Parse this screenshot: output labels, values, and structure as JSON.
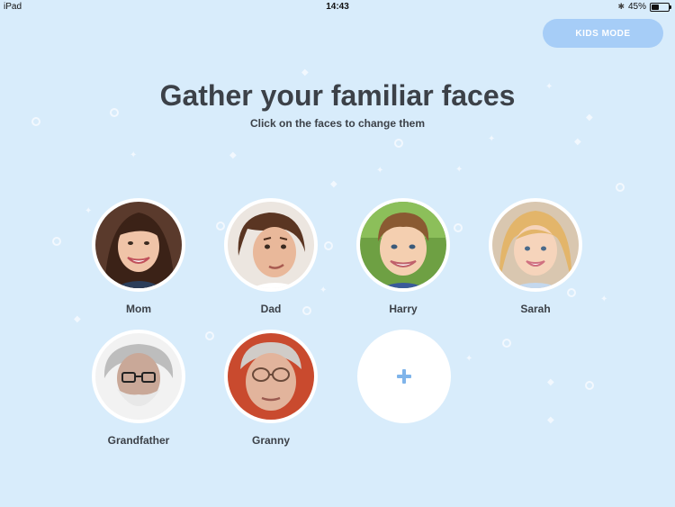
{
  "status_bar": {
    "device": "iPad",
    "time": "14:43",
    "battery": "45%",
    "battery_level": 0.45
  },
  "kids_mode_button": "KIDS MODE",
  "title": "Gather your familiar faces",
  "subtitle": "Click on the faces to change them",
  "faces": [
    {
      "label": "Mom"
    },
    {
      "label": "Dad"
    },
    {
      "label": "Harry"
    },
    {
      "label": "Sarah"
    },
    {
      "label": "Grandfather"
    },
    {
      "label": "Granny"
    }
  ],
  "colors": {
    "background": "#d8ecfb",
    "accent": "#a6cdf7",
    "plus": "#7fb4ea",
    "text": "#3c4148"
  },
  "icons": {
    "add": "plus-icon",
    "bluetooth": "bluetooth-icon",
    "battery": "battery-icon"
  }
}
